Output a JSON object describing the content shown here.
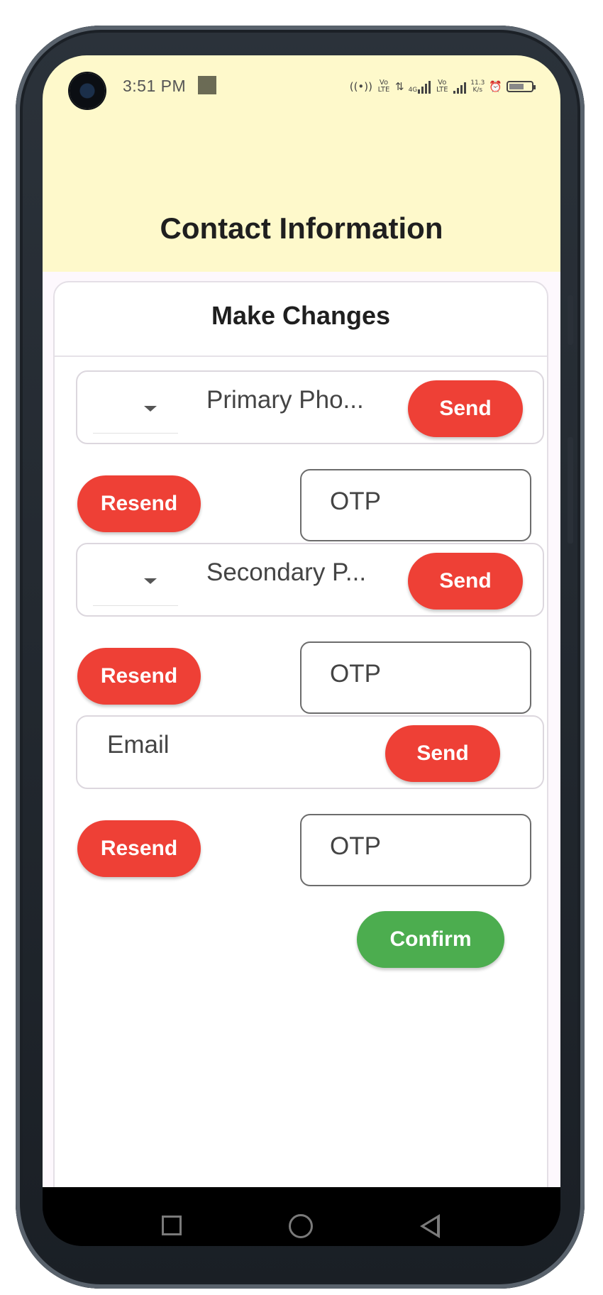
{
  "status_bar": {
    "time": "3:51 PM",
    "icons": [
      "hotspot-icon",
      "volte-icon",
      "data-arrows-icon",
      "4g-signal-icon",
      "volte-icon",
      "signal-icon",
      "network-speed-icon",
      "alarm-icon",
      "battery-icon"
    ],
    "net_speed": "11.3",
    "net_speed_unit": "K/s",
    "volte_text": "Vo LTE",
    "fourg_text": "4G"
  },
  "app": {
    "title": "Contact Information",
    "header_color": "#fef9cb"
  },
  "card": {
    "title": "Make Changes",
    "primary_phone": {
      "placeholder": "Primary Pho...",
      "send_label": "Send",
      "resend_label": "Resend",
      "otp_placeholder": "OTP"
    },
    "secondary_phone": {
      "placeholder": "Secondary P...",
      "send_label": "Send",
      "resend_label": "Resend",
      "otp_placeholder": "OTP"
    },
    "email": {
      "placeholder": "Email",
      "send_label": "Send",
      "resend_label": "Resend",
      "otp_placeholder": "OTP"
    },
    "confirm_label": "Confirm"
  },
  "colors": {
    "action_red": "#ee4036",
    "confirm_green": "#4cad4f"
  },
  "nav_bar": {
    "icons": [
      "recents-icon",
      "home-icon",
      "back-icon"
    ]
  }
}
